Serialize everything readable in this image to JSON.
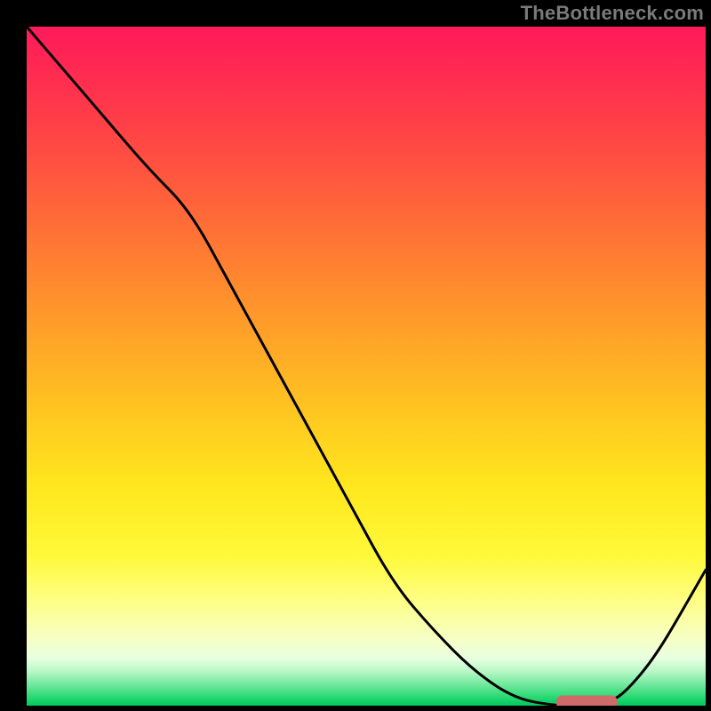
{
  "watermark": "TheBottleneck.com",
  "colors": {
    "frame": "#000000",
    "curve": "#000000",
    "marker": "#d06a6a",
    "gradient_top": "#ff1a5a",
    "gradient_bottom": "#00c85a"
  },
  "chart_data": {
    "type": "line",
    "title": "",
    "xlabel": "",
    "ylabel": "",
    "xlim": [
      0,
      100
    ],
    "ylim": [
      0,
      100
    ],
    "grid": false,
    "legend": false,
    "series": [
      {
        "name": "bottleneck-curve",
        "x": [
          0,
          6,
          12,
          18,
          24,
          30,
          36,
          42,
          48,
          54,
          60,
          66,
          72,
          78,
          81,
          84,
          87,
          90,
          93,
          96,
          100
        ],
        "y": [
          100,
          93,
          86,
          79,
          73,
          62,
          51,
          40,
          29,
          18,
          11,
          5,
          1,
          0,
          0,
          0,
          1,
          4,
          8,
          13,
          20
        ]
      }
    ],
    "marker": {
      "name": "optimal-range",
      "shape": "rounded-bar",
      "x_start": 78,
      "x_end": 87,
      "y": 0.5,
      "height": 2,
      "color": "#d06a6a"
    },
    "annotations": []
  }
}
